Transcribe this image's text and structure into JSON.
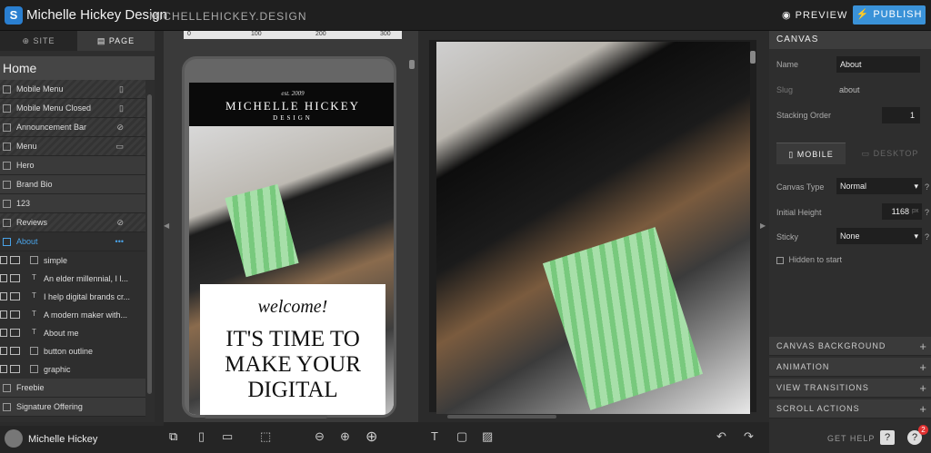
{
  "header": {
    "site_name": "Michelle Hickey Design",
    "domain": "MICHELLEHICKEY.DESIGN",
    "preview": "PREVIEW",
    "publish": "PUBLISH"
  },
  "left_tabs": {
    "site": "SITE",
    "page": "PAGE"
  },
  "page_title": "Home",
  "layers": [
    {
      "label": "Mobile Menu",
      "device": "mobile"
    },
    {
      "label": "Mobile Menu Closed",
      "device": "mobile"
    },
    {
      "label": "Announcement Bar",
      "device": "hidden"
    },
    {
      "label": "Menu",
      "device": "desktop"
    },
    {
      "label": "Hero"
    },
    {
      "label": "Brand Bio"
    },
    {
      "label": "123"
    },
    {
      "label": "Reviews",
      "device": "hidden"
    },
    {
      "label": "About",
      "more": "•••"
    }
  ],
  "about_children": [
    "simple",
    "An elder millennial, I l...",
    "I help digital brands cr...",
    "A modern maker with...",
    "About me",
    "button outline",
    "graphic"
  ],
  "layers_after": [
    "Freebie",
    "Signature Offering"
  ],
  "user": {
    "name": "Michelle Hickey"
  },
  "ruler": {
    "t0": "0",
    "t1": "100",
    "t2": "200",
    "t3": "300"
  },
  "mobile_preview": {
    "est": "est. 2009",
    "brand_name": "MICHELLE HICKEY",
    "brand_sub": "DESIGN",
    "welcome": "welcome!",
    "headline": "IT'S TIME TO MAKE YOUR DIGITAL"
  },
  "right_panel": {
    "section_title": "CANVAS",
    "name_label": "Name",
    "name_value": "About",
    "slug_label": "Slug",
    "slug_value": "about",
    "stacking_label": "Stacking Order",
    "stacking_value": "1",
    "tab_mobile": "MOBILE",
    "tab_desktop": "DESKTOP",
    "canvas_type_label": "Canvas Type",
    "canvas_type_value": "Normal",
    "initial_height_label": "Initial Height",
    "initial_height_value": "1168",
    "initial_height_unit": "px",
    "sticky_label": "Sticky",
    "sticky_value": "None",
    "hidden_label": "Hidden to start",
    "sections": [
      "CANVAS BACKGROUND",
      "ANIMATION",
      "VIEW TRANSITIONS",
      "SCROLL ACTIONS"
    ]
  },
  "footer": {
    "get_help": "GET HELP",
    "help_badge": "2"
  }
}
